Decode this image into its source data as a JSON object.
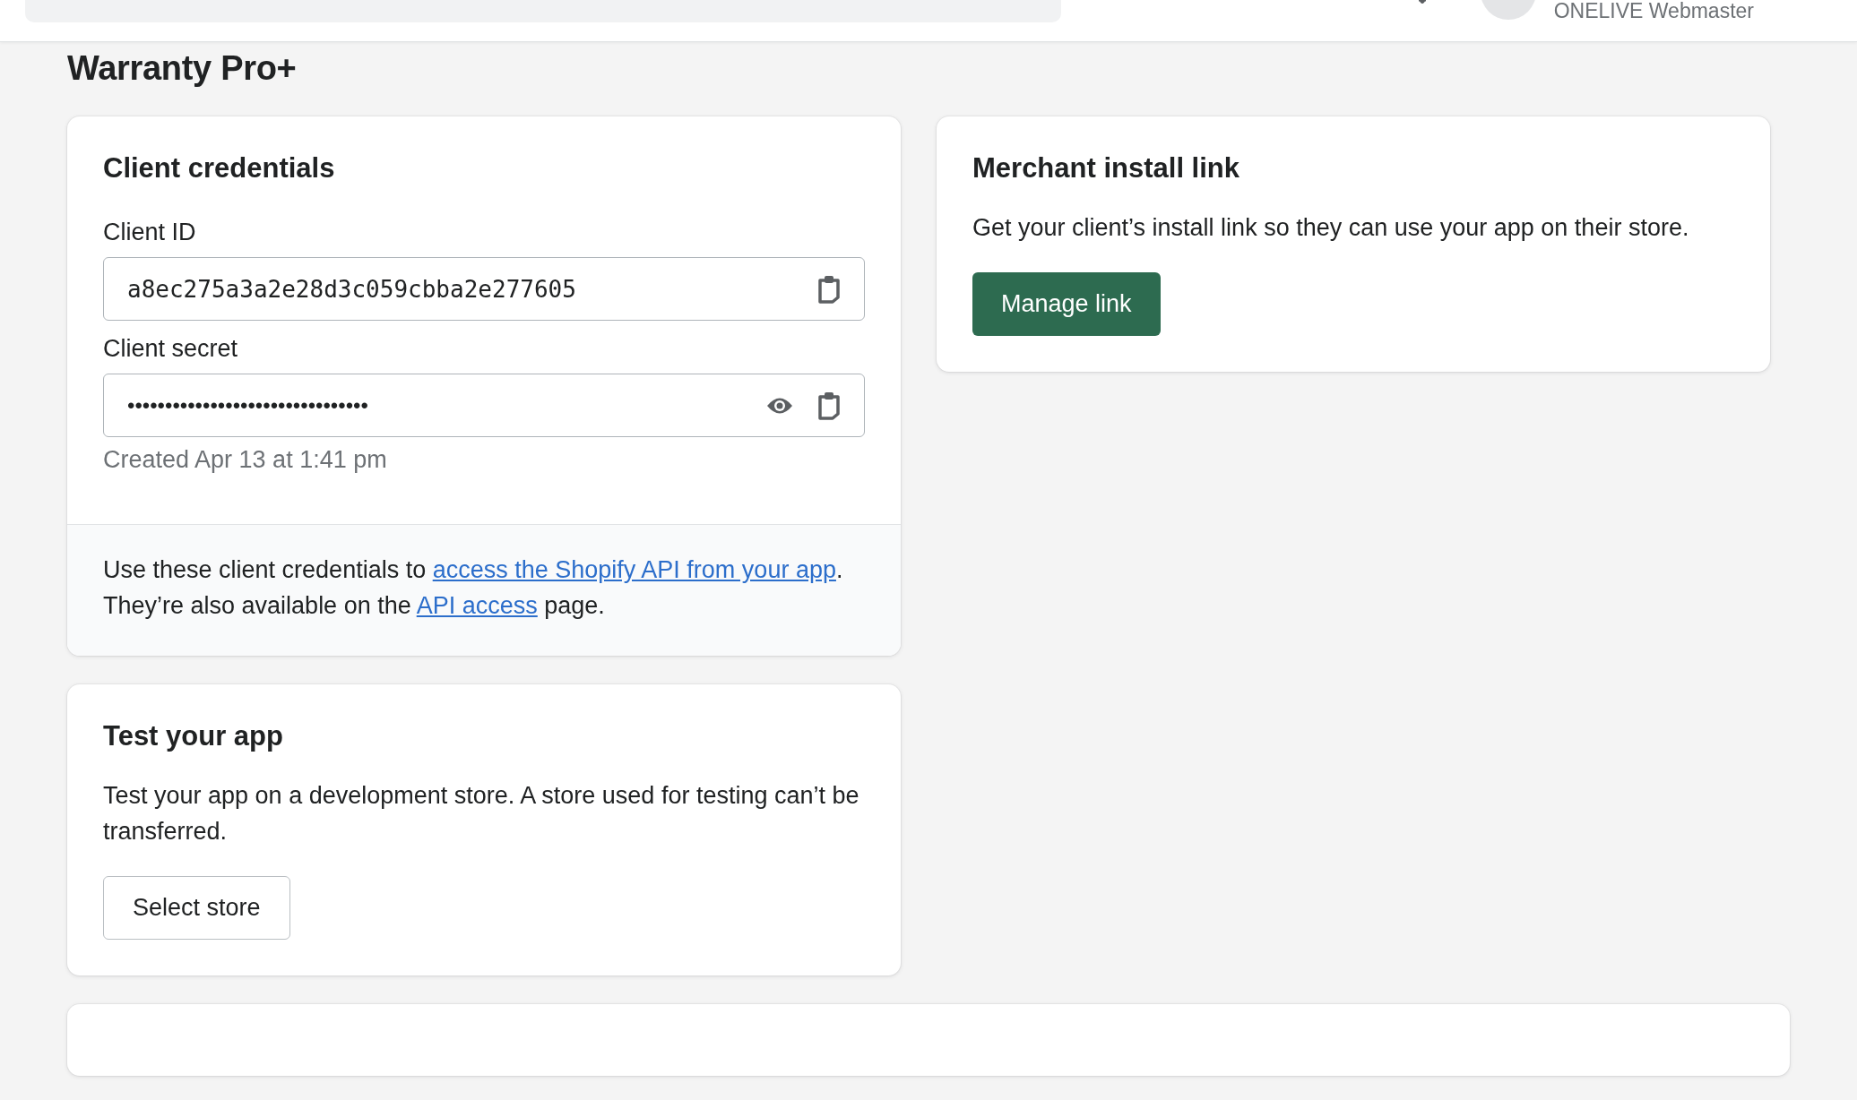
{
  "top_bar": {
    "user_name": "ONELIVE Webmaster"
  },
  "page_title": "Warranty Pro+",
  "client_credentials": {
    "title": "Client credentials",
    "fields": [
      {
        "kind": "id",
        "label": "Client ID",
        "value": "a8ec275a3a2e28d3c059cbba2e277605"
      },
      {
        "kind": "secret",
        "label": "Client secret",
        "value": "••••••••••••••••••••••••••••••••",
        "help": "Created Apr 13 at 1:41 pm"
      }
    ],
    "footer": [
      {
        "kind": "text",
        "text": "Use these client credentials to "
      },
      {
        "kind": "link",
        "text": "access the Shopify API from your app"
      },
      {
        "kind": "text",
        "text": ". They’re also available on the "
      },
      {
        "kind": "link",
        "text": "API access"
      },
      {
        "kind": "text",
        "text": " page."
      }
    ]
  },
  "test_app": {
    "title": "Test your app",
    "text": "Test your app on a development store. A store used for testing can’t be transferred.",
    "button": "Select store"
  },
  "merchant_link": {
    "title": "Merchant install link",
    "text": "Get your client’s install link so they can use your app on their store.",
    "button": "Manage link"
  }
}
